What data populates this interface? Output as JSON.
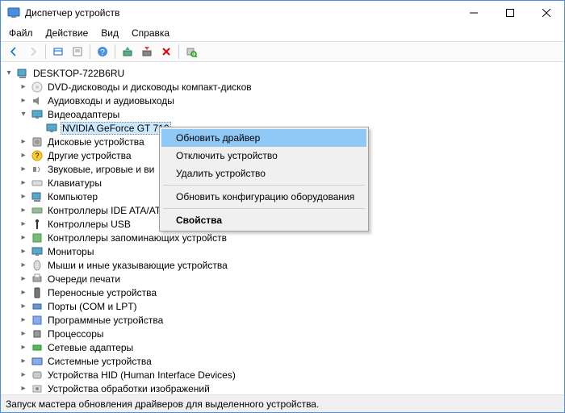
{
  "title": "Диспетчер устройств",
  "menubar": [
    "Файл",
    "Действие",
    "Вид",
    "Справка"
  ],
  "root": "DESKTOP-722B6RU",
  "tree": [
    {
      "id": "dvd",
      "label": "DVD-дисководы и дисководы компакт-дисков",
      "expanded": false,
      "depth": 1,
      "icon": "disc"
    },
    {
      "id": "audio",
      "label": "Аудиовходы и аудиовыходы",
      "expanded": false,
      "depth": 1,
      "icon": "audio"
    },
    {
      "id": "video",
      "label": "Видеоадаптеры",
      "expanded": true,
      "depth": 1,
      "icon": "monitor"
    },
    {
      "id": "nvidia",
      "label": "NVIDIA GeForce GT 710",
      "expanded": null,
      "depth": 2,
      "icon": "monitor",
      "selected": true
    },
    {
      "id": "disk",
      "label": "Дисковые устройства",
      "expanded": false,
      "depth": 1,
      "icon": "disk"
    },
    {
      "id": "other",
      "label": "Другие устройства",
      "expanded": false,
      "depth": 1,
      "icon": "other"
    },
    {
      "id": "sound",
      "label": "Звуковые, игровые и видеоустройства",
      "expanded": false,
      "depth": 1,
      "icon": "sound",
      "truncated": "Звуковые, игровые и ви"
    },
    {
      "id": "kbd",
      "label": "Клавиатуры",
      "expanded": false,
      "depth": 1,
      "icon": "kbd"
    },
    {
      "id": "pc",
      "label": "Компьютер",
      "expanded": false,
      "depth": 1,
      "icon": "pc"
    },
    {
      "id": "ide",
      "label": "Контроллеры IDE ATA/ATAPI",
      "expanded": false,
      "depth": 1,
      "icon": "ide",
      "truncated": "Контроллеры IDE ATA/AT"
    },
    {
      "id": "usb",
      "label": "Контроллеры USB",
      "expanded": false,
      "depth": 1,
      "icon": "usb"
    },
    {
      "id": "storage",
      "label": "Контроллеры запоминающих устройств",
      "expanded": false,
      "depth": 1,
      "icon": "storage"
    },
    {
      "id": "monitors",
      "label": "Мониторы",
      "expanded": false,
      "depth": 1,
      "icon": "monitor"
    },
    {
      "id": "mouse",
      "label": "Мыши и иные указывающие устройства",
      "expanded": false,
      "depth": 1,
      "icon": "mouse"
    },
    {
      "id": "print",
      "label": "Очереди печати",
      "expanded": false,
      "depth": 1,
      "icon": "print"
    },
    {
      "id": "portable",
      "label": "Переносные устройства",
      "expanded": false,
      "depth": 1,
      "icon": "portable"
    },
    {
      "id": "ports",
      "label": "Порты (COM и LPT)",
      "expanded": false,
      "depth": 1,
      "icon": "port"
    },
    {
      "id": "soft",
      "label": "Программные устройства",
      "expanded": false,
      "depth": 1,
      "icon": "soft"
    },
    {
      "id": "cpu",
      "label": "Процессоры",
      "expanded": false,
      "depth": 1,
      "icon": "cpu"
    },
    {
      "id": "net",
      "label": "Сетевые адаптеры",
      "expanded": false,
      "depth": 1,
      "icon": "net"
    },
    {
      "id": "sys",
      "label": "Системные устройства",
      "expanded": false,
      "depth": 1,
      "icon": "sys"
    },
    {
      "id": "hid",
      "label": "Устройства HID (Human Interface Devices)",
      "expanded": false,
      "depth": 1,
      "icon": "hid"
    },
    {
      "id": "img",
      "label": "Устройства обработки изображений",
      "expanded": false,
      "depth": 1,
      "icon": "img"
    }
  ],
  "context": [
    {
      "label": "Обновить драйвер",
      "highlighted": true
    },
    {
      "label": "Отключить устройство"
    },
    {
      "label": "Удалить устройство"
    },
    {
      "sep": true
    },
    {
      "label": "Обновить конфигурацию оборудования"
    },
    {
      "sep": true
    },
    {
      "label": "Свойства",
      "bold": true
    }
  ],
  "status": "Запуск мастера обновления драйверов для выделенного устройства."
}
